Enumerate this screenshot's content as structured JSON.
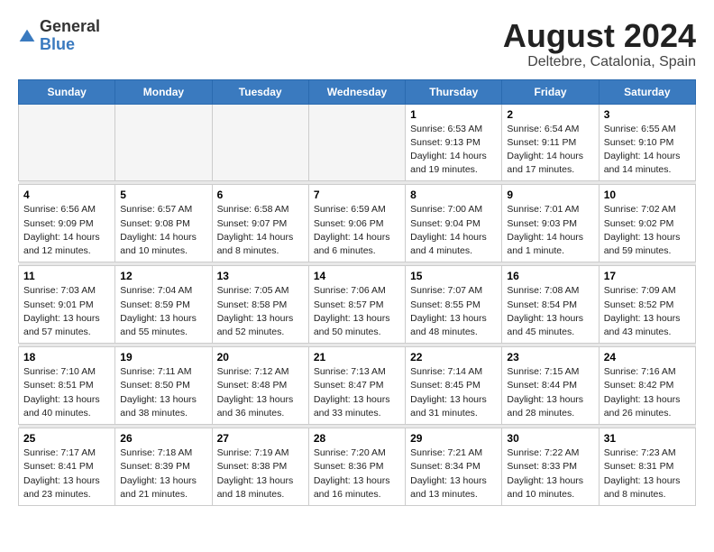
{
  "header": {
    "logo_general": "General",
    "logo_blue": "Blue",
    "title": "August 2024",
    "subtitle": "Deltebre, Catalonia, Spain"
  },
  "columns": [
    "Sunday",
    "Monday",
    "Tuesday",
    "Wednesday",
    "Thursday",
    "Friday",
    "Saturday"
  ],
  "weeks": [
    {
      "days": [
        {
          "date": "",
          "info": ""
        },
        {
          "date": "",
          "info": ""
        },
        {
          "date": "",
          "info": ""
        },
        {
          "date": "",
          "info": ""
        },
        {
          "date": "1",
          "info": "Sunrise: 6:53 AM\nSunset: 9:13 PM\nDaylight: 14 hours\nand 19 minutes."
        },
        {
          "date": "2",
          "info": "Sunrise: 6:54 AM\nSunset: 9:11 PM\nDaylight: 14 hours\nand 17 minutes."
        },
        {
          "date": "3",
          "info": "Sunrise: 6:55 AM\nSunset: 9:10 PM\nDaylight: 14 hours\nand 14 minutes."
        }
      ]
    },
    {
      "days": [
        {
          "date": "4",
          "info": "Sunrise: 6:56 AM\nSunset: 9:09 PM\nDaylight: 14 hours\nand 12 minutes."
        },
        {
          "date": "5",
          "info": "Sunrise: 6:57 AM\nSunset: 9:08 PM\nDaylight: 14 hours\nand 10 minutes."
        },
        {
          "date": "6",
          "info": "Sunrise: 6:58 AM\nSunset: 9:07 PM\nDaylight: 14 hours\nand 8 minutes."
        },
        {
          "date": "7",
          "info": "Sunrise: 6:59 AM\nSunset: 9:06 PM\nDaylight: 14 hours\nand 6 minutes."
        },
        {
          "date": "8",
          "info": "Sunrise: 7:00 AM\nSunset: 9:04 PM\nDaylight: 14 hours\nand 4 minutes."
        },
        {
          "date": "9",
          "info": "Sunrise: 7:01 AM\nSunset: 9:03 PM\nDaylight: 14 hours\nand 1 minute."
        },
        {
          "date": "10",
          "info": "Sunrise: 7:02 AM\nSunset: 9:02 PM\nDaylight: 13 hours\nand 59 minutes."
        }
      ]
    },
    {
      "days": [
        {
          "date": "11",
          "info": "Sunrise: 7:03 AM\nSunset: 9:01 PM\nDaylight: 13 hours\nand 57 minutes."
        },
        {
          "date": "12",
          "info": "Sunrise: 7:04 AM\nSunset: 8:59 PM\nDaylight: 13 hours\nand 55 minutes."
        },
        {
          "date": "13",
          "info": "Sunrise: 7:05 AM\nSunset: 8:58 PM\nDaylight: 13 hours\nand 52 minutes."
        },
        {
          "date": "14",
          "info": "Sunrise: 7:06 AM\nSunset: 8:57 PM\nDaylight: 13 hours\nand 50 minutes."
        },
        {
          "date": "15",
          "info": "Sunrise: 7:07 AM\nSunset: 8:55 PM\nDaylight: 13 hours\nand 48 minutes."
        },
        {
          "date": "16",
          "info": "Sunrise: 7:08 AM\nSunset: 8:54 PM\nDaylight: 13 hours\nand 45 minutes."
        },
        {
          "date": "17",
          "info": "Sunrise: 7:09 AM\nSunset: 8:52 PM\nDaylight: 13 hours\nand 43 minutes."
        }
      ]
    },
    {
      "days": [
        {
          "date": "18",
          "info": "Sunrise: 7:10 AM\nSunset: 8:51 PM\nDaylight: 13 hours\nand 40 minutes."
        },
        {
          "date": "19",
          "info": "Sunrise: 7:11 AM\nSunset: 8:50 PM\nDaylight: 13 hours\nand 38 minutes."
        },
        {
          "date": "20",
          "info": "Sunrise: 7:12 AM\nSunset: 8:48 PM\nDaylight: 13 hours\nand 36 minutes."
        },
        {
          "date": "21",
          "info": "Sunrise: 7:13 AM\nSunset: 8:47 PM\nDaylight: 13 hours\nand 33 minutes."
        },
        {
          "date": "22",
          "info": "Sunrise: 7:14 AM\nSunset: 8:45 PM\nDaylight: 13 hours\nand 31 minutes."
        },
        {
          "date": "23",
          "info": "Sunrise: 7:15 AM\nSunset: 8:44 PM\nDaylight: 13 hours\nand 28 minutes."
        },
        {
          "date": "24",
          "info": "Sunrise: 7:16 AM\nSunset: 8:42 PM\nDaylight: 13 hours\nand 26 minutes."
        }
      ]
    },
    {
      "days": [
        {
          "date": "25",
          "info": "Sunrise: 7:17 AM\nSunset: 8:41 PM\nDaylight: 13 hours\nand 23 minutes."
        },
        {
          "date": "26",
          "info": "Sunrise: 7:18 AM\nSunset: 8:39 PM\nDaylight: 13 hours\nand 21 minutes."
        },
        {
          "date": "27",
          "info": "Sunrise: 7:19 AM\nSunset: 8:38 PM\nDaylight: 13 hours\nand 18 minutes."
        },
        {
          "date": "28",
          "info": "Sunrise: 7:20 AM\nSunset: 8:36 PM\nDaylight: 13 hours\nand 16 minutes."
        },
        {
          "date": "29",
          "info": "Sunrise: 7:21 AM\nSunset: 8:34 PM\nDaylight: 13 hours\nand 13 minutes."
        },
        {
          "date": "30",
          "info": "Sunrise: 7:22 AM\nSunset: 8:33 PM\nDaylight: 13 hours\nand 10 minutes."
        },
        {
          "date": "31",
          "info": "Sunrise: 7:23 AM\nSunset: 8:31 PM\nDaylight: 13 hours\nand 8 minutes."
        }
      ]
    }
  ]
}
